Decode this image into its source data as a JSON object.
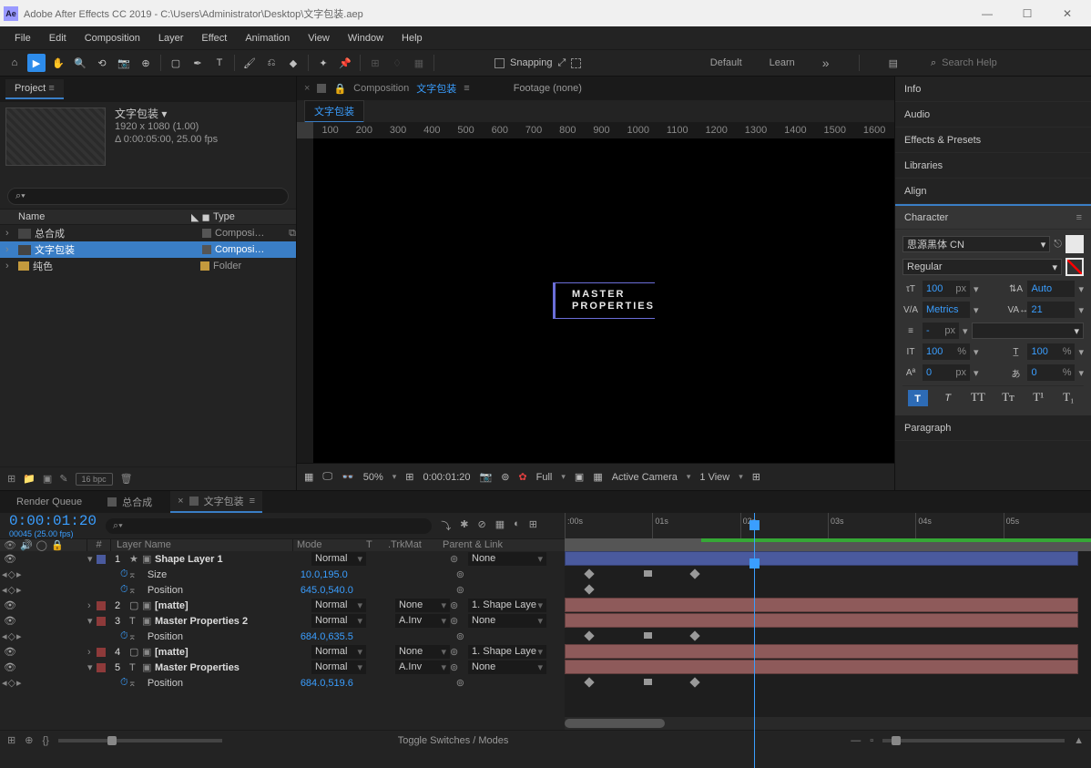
{
  "window": {
    "title": "Adobe After Effects CC 2019 - C:\\Users\\Administrator\\Desktop\\文字包装.aep",
    "icon_text": "Ae"
  },
  "menubar": [
    "File",
    "Edit",
    "Composition",
    "Layer",
    "Effect",
    "Animation",
    "View",
    "Window",
    "Help"
  ],
  "toolbar": {
    "snapping_label": "Snapping",
    "workspaces": [
      "Default",
      "Learn"
    ],
    "search_placeholder": "Search Help"
  },
  "project_panel": {
    "tab": "Project",
    "comp_name": "文字包装 ▾",
    "comp_res": "1920 x 1080 (1.00)",
    "comp_dur": "Δ 0:00:05:00, 25.00 fps",
    "search_placeholder": "",
    "columns": {
      "name": "Name",
      "type": "Type"
    },
    "items": [
      {
        "name": "总合成",
        "type": "Composi…",
        "kind": "comp"
      },
      {
        "name": "文字包装",
        "type": "Composi…",
        "kind": "comp",
        "selected": true
      },
      {
        "name": "纯色",
        "type": "Folder",
        "kind": "folder"
      }
    ],
    "footer_bpc": "16 bpc"
  },
  "viewer": {
    "tab_prefix": "Composition",
    "tab_active": "文字包装",
    "footage_label": "Footage  (none)",
    "subtab": "文字包装",
    "ruler_ticks": [
      "100",
      "200",
      "300",
      "400",
      "500",
      "600",
      "700",
      "800",
      "900",
      "1000",
      "1100",
      "1200",
      "1300",
      "1400",
      "1500",
      "1600"
    ],
    "text_line1": "MASTER",
    "text_line2": "PROPERTIES",
    "footer": {
      "zoom": "50%",
      "time": "0:00:01:20",
      "res": "Full",
      "camera": "Active Camera",
      "views": "1 View"
    }
  },
  "right_panels": {
    "collapsed": [
      "Info",
      "Audio",
      "Effects & Presets",
      "Libraries",
      "Align"
    ],
    "character_title": "Character",
    "paragraph_title": "Paragraph",
    "character": {
      "font": "思源黑体 CN",
      "style": "Regular",
      "size": "100",
      "size_unit": "px",
      "leading": "Auto",
      "kerning": "Metrics",
      "tracking": "21",
      "stroke_width": "-",
      "stroke_unit": "px",
      "vscale": "100",
      "vscale_unit": "%",
      "hscale": "100",
      "hscale_unit": "%",
      "baseline": "0",
      "baseline_unit": "px",
      "tsume": "0",
      "tsume_unit": "%"
    }
  },
  "timeline": {
    "tabs": {
      "render_queue": "Render Queue",
      "comp1": "总合成",
      "comp2": "文字包装"
    },
    "timecode": "0:00:01:20",
    "fps": "00045 (25.00 fps)",
    "col_headers": {
      "layer_name": "Layer Name",
      "mode": "Mode",
      "t": "T",
      "trkmat": ".TrkMat",
      "parent": "Parent & Link"
    },
    "time_ticks": [
      ":00s",
      "01s",
      "02s",
      "03s",
      "04s",
      "05s"
    ],
    "layers": [
      {
        "num": "1",
        "name": "Shape Layer 1",
        "mode": "Normal",
        "trkmat": "",
        "parent": "None",
        "color": "tag-blue",
        "star": true,
        "props": [
          {
            "name": "Size",
            "value": "10.0,195.0"
          },
          {
            "name": "Position",
            "value": "645.0,540.0"
          }
        ]
      },
      {
        "num": "2",
        "name": "[matte]",
        "mode": "Normal",
        "trkmat": "None",
        "parent": "1. Shape Laye",
        "color": "tag-red"
      },
      {
        "num": "3",
        "name": "Master Properties 2",
        "mode": "Normal",
        "trkmat": "A.Inv",
        "parent": "None",
        "color": "tag-red",
        "type": "T",
        "props": [
          {
            "name": "Position",
            "value": "684.0,635.5"
          }
        ]
      },
      {
        "num": "4",
        "name": "[matte]",
        "mode": "Normal",
        "trkmat": "None",
        "parent": "1. Shape Laye",
        "color": "tag-red"
      },
      {
        "num": "5",
        "name": "Master Properties",
        "mode": "Normal",
        "trkmat": "A.Inv",
        "parent": "None",
        "color": "tag-red",
        "type": "T",
        "props": [
          {
            "name": "Position",
            "value": "684.0,519.6"
          }
        ]
      }
    ],
    "footer_label": "Toggle Switches / Modes"
  }
}
